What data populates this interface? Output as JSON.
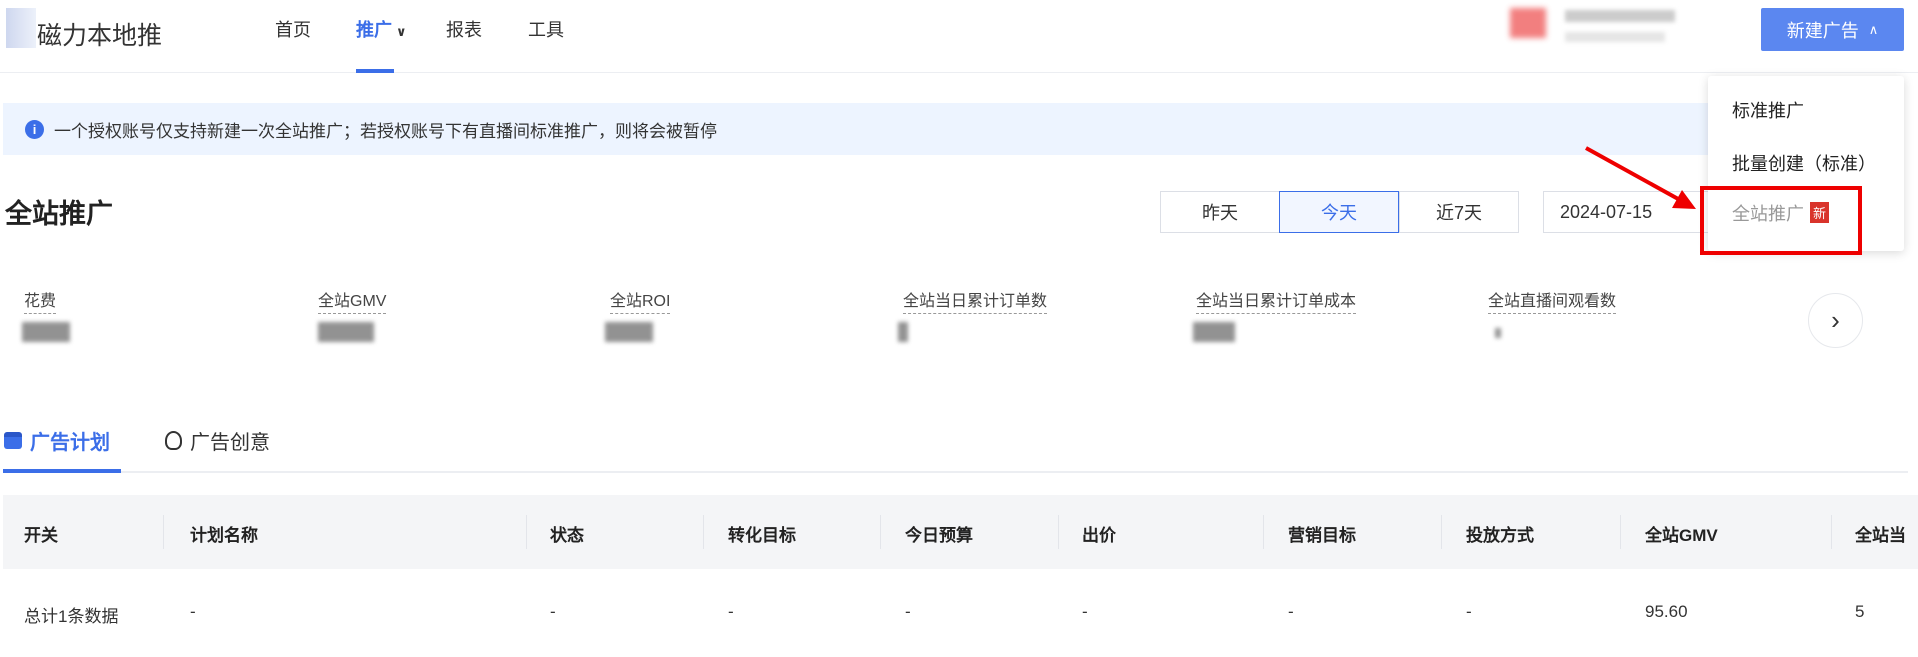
{
  "header": {
    "logo_text": "磁力本地推",
    "nav": [
      {
        "label": "首页"
      },
      {
        "label": "推广",
        "active": true,
        "chevron": "chevron-down-icon"
      },
      {
        "label": "报表"
      },
      {
        "label": "工具"
      }
    ],
    "new_ad_button": "新建广告"
  },
  "dropdown": {
    "items": [
      {
        "label": "标准推广"
      },
      {
        "label": "批量创建（标准）"
      },
      {
        "label": "全站推广",
        "badge": "新",
        "highlighted": true
      }
    ]
  },
  "banner": {
    "text": "一个授权账号仅支持新建一次全站推广；若授权账号下有直播间标准推广，则将会被暂停"
  },
  "page": {
    "title": "全站推广",
    "date_ranges": [
      "昨天",
      "今天",
      "近7天"
    ],
    "active_range": "今天",
    "date_value": "2024-07-15"
  },
  "metrics": [
    {
      "label": "花费"
    },
    {
      "label": "全站GMV"
    },
    {
      "label": "全站ROI"
    },
    {
      "label": "全站当日累计订单数"
    },
    {
      "label": "全站当日累计订单成本"
    },
    {
      "label": "全站直播间观看数"
    }
  ],
  "tabs": [
    {
      "label": "广告计划",
      "active": true
    },
    {
      "label": "广告创意"
    }
  ],
  "table": {
    "columns": [
      "开关",
      "计划名称",
      "状态",
      "转化目标",
      "今日预算",
      "出价",
      "营销目标",
      "投放方式",
      "全站GMV",
      "全站当"
    ],
    "rows": [
      [
        "总计1条数据",
        "-",
        "-",
        "-",
        "-",
        "-",
        "-",
        "-",
        "95.60",
        "5"
      ]
    ]
  },
  "colors": {
    "accent": "#3b6ee8",
    "button": "#5b87f0",
    "highlight": "#ee0000",
    "badge": "#d9342b"
  }
}
